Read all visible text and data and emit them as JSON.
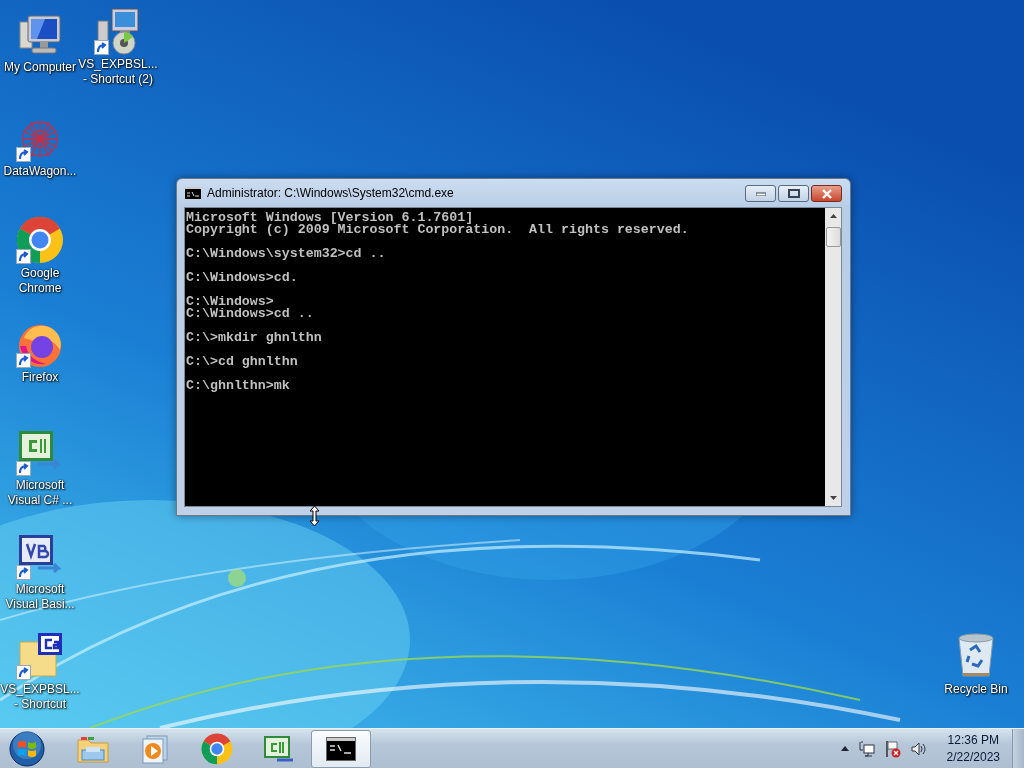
{
  "desktop_icons": [
    {
      "label": "My Computer",
      "kind": "computer",
      "shortcut": false
    },
    {
      "label": "VS_EXPBSL...\n- Shortcut (2)",
      "kind": "installer",
      "shortcut": true
    },
    {
      "label": "DataWagon...",
      "kind": "datawagon",
      "shortcut": true
    },
    {
      "label": "Google\nChrome",
      "kind": "chrome",
      "shortcut": true
    },
    {
      "label": "Firefox",
      "kind": "firefox",
      "shortcut": true
    },
    {
      "label": "Microsoft\nVisual C# ...",
      "kind": "csharp",
      "shortcut": true
    },
    {
      "label": "Microsoft\nVisual Basi...",
      "kind": "vb",
      "shortcut": true
    },
    {
      "label": "VS_EXPBSL...\n- Shortcut",
      "kind": "cafile",
      "shortcut": true
    },
    {
      "label": "Recycle Bin",
      "kind": "recycle",
      "shortcut": false
    }
  ],
  "window": {
    "title": "Administrator: C:\\Windows\\System32\\cmd.exe",
    "console_text": "Microsoft Windows [Version 6.1.7601]\nCopyright (c) 2009 Microsoft Corporation.  All rights reserved.\n\nC:\\Windows\\system32>cd ..\n\nC:\\Windows>cd.\n\nC:\\Windows>\nC:\\Windows>cd ..\n\nC:\\>mkdir ghnlthn\n\nC:\\>cd ghnlthn\n\nC:\\ghnlthn>mk"
  },
  "taskbar": {
    "items": [
      {
        "kind": "explorer",
        "selected": false
      },
      {
        "kind": "media",
        "selected": false
      },
      {
        "kind": "chrome",
        "selected": false
      },
      {
        "kind": "csharp",
        "selected": false
      },
      {
        "kind": "cmd",
        "selected": true
      }
    ],
    "time": "12:36 PM",
    "date": "2/22/2023"
  }
}
